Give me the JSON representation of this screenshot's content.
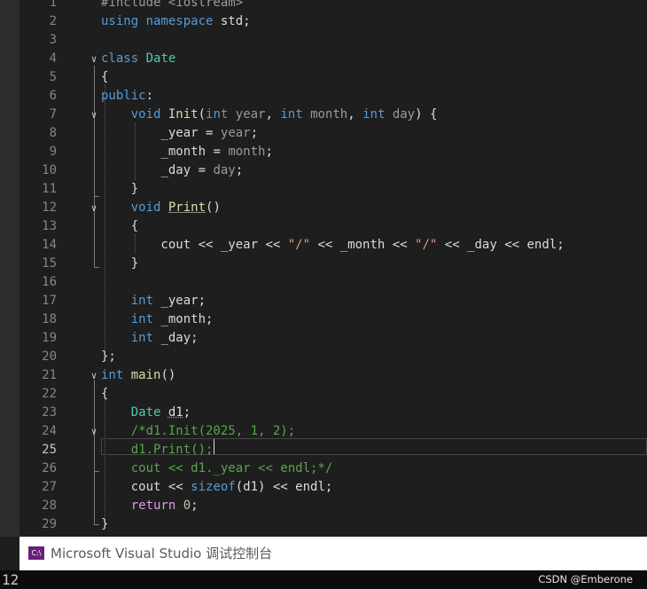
{
  "editor": {
    "active_line": 25,
    "colors": {
      "background": "#1e1e1e",
      "text": "#dcdcdc",
      "keyword": "#569cd6",
      "type": "#4ec9b0",
      "function": "#dcdcaa",
      "string": "#d69d85",
      "comment": "#57a64a",
      "number": "#b5cea8",
      "control": "#d8a0df",
      "field": "#dadada",
      "parameter": "#9a9a9a",
      "preprocessor": "#9b9b9b",
      "line_number": "#858585"
    },
    "lines": [
      {
        "n": "1",
        "fold": "",
        "tokens": [
          {
            "t": "#include <iostream>",
            "k": "preprocessor"
          }
        ]
      },
      {
        "n": "2",
        "fold": "",
        "tokens": [
          {
            "t": "using namespace",
            "k": "keyword"
          },
          {
            "t": " std;",
            "k": "plain"
          }
        ]
      },
      {
        "n": "3",
        "fold": "",
        "tokens": []
      },
      {
        "n": "4",
        "fold": "v",
        "tokens": [
          {
            "t": "class",
            "k": "keyword"
          },
          {
            "t": " ",
            "k": "plain"
          },
          {
            "t": "Date",
            "k": "type"
          }
        ]
      },
      {
        "n": "5",
        "fold": "",
        "tokens": [
          {
            "t": "{",
            "k": "plain"
          }
        ]
      },
      {
        "n": "6",
        "fold": "",
        "tokens": [
          {
            "t": "public",
            "k": "keyword"
          },
          {
            "t": ":",
            "k": "plain"
          }
        ]
      },
      {
        "n": "7",
        "fold": "v",
        "tokens": [
          {
            "t": "    ",
            "k": "plain"
          },
          {
            "t": "void",
            "k": "keyword"
          },
          {
            "t": " ",
            "k": "plain"
          },
          {
            "t": "Init",
            "k": "function"
          },
          {
            "t": "(",
            "k": "plain"
          },
          {
            "t": "int",
            "k": "keyword"
          },
          {
            "t": " ",
            "k": "plain"
          },
          {
            "t": "year",
            "k": "parameter"
          },
          {
            "t": ", ",
            "k": "plain"
          },
          {
            "t": "int",
            "k": "keyword"
          },
          {
            "t": " ",
            "k": "plain"
          },
          {
            "t": "month",
            "k": "parameter"
          },
          {
            "t": ", ",
            "k": "plain"
          },
          {
            "t": "int",
            "k": "keyword"
          },
          {
            "t": " ",
            "k": "plain"
          },
          {
            "t": "day",
            "k": "parameter"
          },
          {
            "t": ") {",
            "k": "plain"
          }
        ]
      },
      {
        "n": "8",
        "fold": "",
        "tokens": [
          {
            "t": "        ",
            "k": "plain"
          },
          {
            "t": "_year",
            "k": "field"
          },
          {
            "t": " = ",
            "k": "plain"
          },
          {
            "t": "year",
            "k": "parameter"
          },
          {
            "t": ";",
            "k": "plain"
          }
        ]
      },
      {
        "n": "9",
        "fold": "",
        "tokens": [
          {
            "t": "        ",
            "k": "plain"
          },
          {
            "t": "_month",
            "k": "field"
          },
          {
            "t": " = ",
            "k": "plain"
          },
          {
            "t": "month",
            "k": "parameter"
          },
          {
            "t": ";",
            "k": "plain"
          }
        ]
      },
      {
        "n": "10",
        "fold": "",
        "tokens": [
          {
            "t": "        ",
            "k": "plain"
          },
          {
            "t": "_day",
            "k": "field"
          },
          {
            "t": " = ",
            "k": "plain"
          },
          {
            "t": "day",
            "k": "parameter"
          },
          {
            "t": ";",
            "k": "plain"
          }
        ]
      },
      {
        "n": "11",
        "fold": "",
        "tokens": [
          {
            "t": "    }",
            "k": "plain"
          }
        ]
      },
      {
        "n": "12",
        "fold": "v",
        "tokens": [
          {
            "t": "    ",
            "k": "plain"
          },
          {
            "t": "void",
            "k": "keyword"
          },
          {
            "t": " ",
            "k": "plain"
          },
          {
            "t": "Print",
            "k": "function",
            "u": "solid"
          },
          {
            "t": "()",
            "k": "plain"
          }
        ]
      },
      {
        "n": "13",
        "fold": "",
        "tokens": [
          {
            "t": "    {",
            "k": "plain"
          }
        ]
      },
      {
        "n": "14",
        "fold": "",
        "tokens": [
          {
            "t": "        cout << ",
            "k": "plain"
          },
          {
            "t": "_year",
            "k": "field"
          },
          {
            "t": " << ",
            "k": "plain"
          },
          {
            "t": "\"/\"",
            "k": "string"
          },
          {
            "t": " << ",
            "k": "plain"
          },
          {
            "t": "_month",
            "k": "field"
          },
          {
            "t": " << ",
            "k": "plain"
          },
          {
            "t": "\"/\"",
            "k": "string"
          },
          {
            "t": " << ",
            "k": "plain"
          },
          {
            "t": "_day",
            "k": "field"
          },
          {
            "t": " << endl;",
            "k": "plain"
          }
        ]
      },
      {
        "n": "15",
        "fold": "",
        "tokens": [
          {
            "t": "    }",
            "k": "plain"
          }
        ]
      },
      {
        "n": "16",
        "fold": "",
        "tokens": []
      },
      {
        "n": "17",
        "fold": "",
        "tokens": [
          {
            "t": "    ",
            "k": "plain"
          },
          {
            "t": "int",
            "k": "keyword"
          },
          {
            "t": " ",
            "k": "plain"
          },
          {
            "t": "_year",
            "k": "field"
          },
          {
            "t": ";",
            "k": "plain"
          }
        ]
      },
      {
        "n": "18",
        "fold": "",
        "tokens": [
          {
            "t": "    ",
            "k": "plain"
          },
          {
            "t": "int",
            "k": "keyword"
          },
          {
            "t": " ",
            "k": "plain"
          },
          {
            "t": "_month",
            "k": "field"
          },
          {
            "t": ";",
            "k": "plain"
          }
        ]
      },
      {
        "n": "19",
        "fold": "",
        "tokens": [
          {
            "t": "    ",
            "k": "plain"
          },
          {
            "t": "int",
            "k": "keyword"
          },
          {
            "t": " ",
            "k": "plain"
          },
          {
            "t": "_day",
            "k": "field"
          },
          {
            "t": ";",
            "k": "plain"
          }
        ]
      },
      {
        "n": "20",
        "fold": "",
        "tokens": [
          {
            "t": "};",
            "k": "plain"
          }
        ]
      },
      {
        "n": "21",
        "fold": "v",
        "tokens": [
          {
            "t": "int",
            "k": "keyword"
          },
          {
            "t": " ",
            "k": "plain"
          },
          {
            "t": "main",
            "k": "function"
          },
          {
            "t": "()",
            "k": "plain"
          }
        ]
      },
      {
        "n": "22",
        "fold": "",
        "tokens": [
          {
            "t": "{",
            "k": "plain"
          }
        ]
      },
      {
        "n": "23",
        "fold": "",
        "tokens": [
          {
            "t": "    ",
            "k": "plain"
          },
          {
            "t": "Date",
            "k": "type"
          },
          {
            "t": " ",
            "k": "plain"
          },
          {
            "t": "d1",
            "k": "plain",
            "u": "dotted"
          },
          {
            "t": ";",
            "k": "plain"
          }
        ]
      },
      {
        "n": "24",
        "fold": "v",
        "tokens": [
          {
            "t": "    ",
            "k": "plain"
          },
          {
            "t": "/*d1.Init(2025, 1, 2);",
            "k": "comment"
          }
        ]
      },
      {
        "n": "25",
        "fold": "",
        "tokens": [
          {
            "t": "    ",
            "k": "plain"
          },
          {
            "t": "d1.Print();",
            "k": "comment"
          }
        ]
      },
      {
        "n": "26",
        "fold": "",
        "tokens": [
          {
            "t": "    ",
            "k": "plain"
          },
          {
            "t": "cout << d1._year << endl;*/",
            "k": "comment"
          }
        ]
      },
      {
        "n": "27",
        "fold": "",
        "tokens": [
          {
            "t": "    cout << ",
            "k": "plain"
          },
          {
            "t": "sizeof",
            "k": "keyword"
          },
          {
            "t": "(d1) << endl;",
            "k": "plain"
          }
        ]
      },
      {
        "n": "28",
        "fold": "",
        "tokens": [
          {
            "t": "    ",
            "k": "plain"
          },
          {
            "t": "return",
            "k": "control"
          },
          {
            "t": " ",
            "k": "plain"
          },
          {
            "t": "0",
            "k": "number"
          },
          {
            "t": ";",
            "k": "plain"
          }
        ]
      },
      {
        "n": "29",
        "fold": "",
        "tokens": [
          {
            "t": "}",
            "k": "plain"
          }
        ]
      }
    ]
  },
  "console": {
    "icon_name": "console-app-icon",
    "icon_glyph": "C:\\",
    "title": "Microsoft Visual Studio 调试控制台",
    "output": "12"
  },
  "watermark": "CSDN @Emberone"
}
